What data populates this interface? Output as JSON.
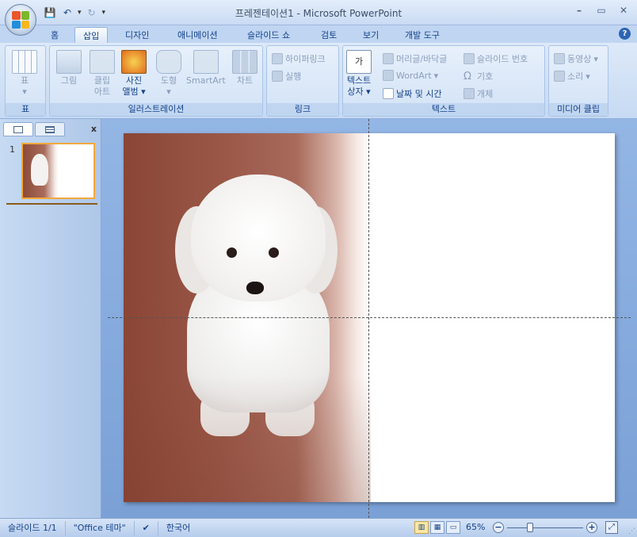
{
  "window": {
    "title": "프레젠테이션1 - Microsoft PowerPoint",
    "min": "–",
    "max": "▭",
    "close": "✕"
  },
  "qat": {
    "dropdown": "▾"
  },
  "tabs": [
    {
      "label": "홈"
    },
    {
      "label": "삽입"
    },
    {
      "label": "디자인"
    },
    {
      "label": "애니메이션"
    },
    {
      "label": "슬라이드 쇼"
    },
    {
      "label": "검토"
    },
    {
      "label": "보기"
    },
    {
      "label": "개발 도구"
    }
  ],
  "help": "?",
  "ribbon": {
    "groups": {
      "table": "표",
      "illustrations": "일러스트레이션",
      "links": "링크",
      "text": "텍스트",
      "media": "미디어 클립"
    },
    "table_btn": "표",
    "picture_btn": "그림",
    "clipart_btn": [
      "클립",
      "아트"
    ],
    "album_btn": [
      "사진",
      "앨범"
    ],
    "shapes_btn": "도형",
    "smartart_btn": "SmartArt",
    "chart_btn": "차트",
    "hyperlink_btn": "하이퍼링크",
    "action_btn": "실행",
    "textbox_btn": [
      "텍스트",
      "상자"
    ],
    "header_btn": "머리글/바닥글",
    "wordart_btn": "WordArt",
    "datetime_btn": "날짜 및 시간",
    "slidenum_btn": "슬라이드 번호",
    "symbol_btn": "기호",
    "object_btn": "개체",
    "movie_btn": "동영상",
    "sound_btn": "소리"
  },
  "left_panel": {
    "slide_number": "1",
    "close": "x"
  },
  "status": {
    "slide": "슬라이드 1/1",
    "theme": "\"Office 테마\"",
    "language": "한국어",
    "zoom": "65%",
    "zoom_level_percent": 65
  },
  "colors": {
    "accent": "#15428b",
    "ribbon_bg": "#c6daf3",
    "selection": "#f3a83b"
  }
}
